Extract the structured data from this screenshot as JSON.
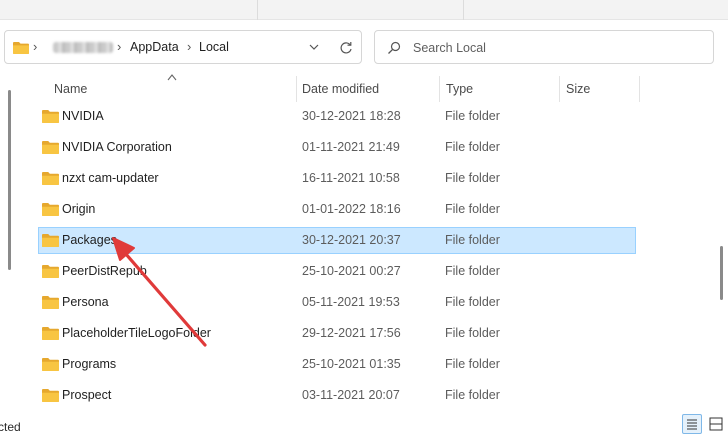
{
  "address": {
    "crumbs": [
      "AppData",
      "Local"
    ]
  },
  "search": {
    "placeholder": "Search Local"
  },
  "columns": {
    "name": "Name",
    "date": "Date modified",
    "type": "Type",
    "size": "Size"
  },
  "files": [
    {
      "name": "NVIDIA",
      "date": "30-12-2021 18:28",
      "type": "File folder"
    },
    {
      "name": "NVIDIA Corporation",
      "date": "01-11-2021 21:49",
      "type": "File folder"
    },
    {
      "name": "nzxt cam-updater",
      "date": "16-11-2021 10:58",
      "type": "File folder"
    },
    {
      "name": "Origin",
      "date": "01-01-2022 18:16",
      "type": "File folder"
    },
    {
      "name": "Packages",
      "date": "30-12-2021 20:37",
      "type": "File folder",
      "selected": true
    },
    {
      "name": "PeerDistRepub",
      "date": "25-10-2021 00:27",
      "type": "File folder"
    },
    {
      "name": "Persona",
      "date": "05-11-2021 19:53",
      "type": "File folder"
    },
    {
      "name": "PlaceholderTileLogoFolder",
      "date": "29-12-2021 17:56",
      "type": "File folder"
    },
    {
      "name": "Programs",
      "date": "25-10-2021 01:35",
      "type": "File folder"
    },
    {
      "name": "Prospect",
      "date": "03-11-2021 20:07",
      "type": "File folder"
    }
  ],
  "status": {
    "text": "cted"
  },
  "icons": {
    "folder": "folder-icon",
    "chevron": "chevron-right-icon",
    "refresh": "refresh-icon",
    "search": "search-icon",
    "details_view": "details-view-icon",
    "tiles_view": "tiles-view-icon"
  },
  "colors": {
    "selection": "#cce8ff",
    "selection_border": "#99d1ff",
    "folder": "#f8c542",
    "annotation_arrow": "#e03a3a"
  }
}
